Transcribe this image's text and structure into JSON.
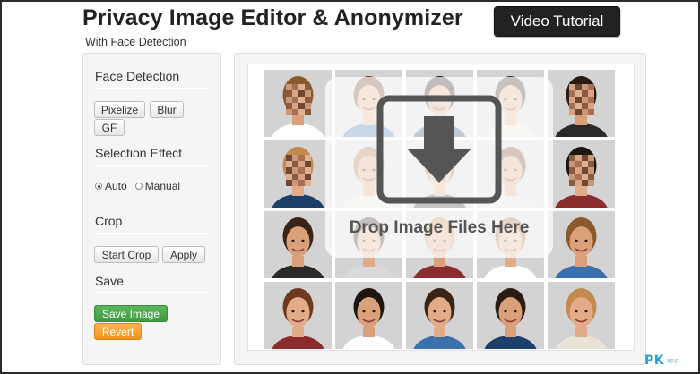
{
  "header": {
    "title": "Privacy Image Editor & Anonymizer",
    "subtitle": "With Face Detection",
    "video_button": "Video Tutorial"
  },
  "sidebar": {
    "face_detection": {
      "title": "Face Detection",
      "buttons": [
        "Pixelize",
        "Blur",
        "GF"
      ]
    },
    "selection_effect": {
      "title": "Selection Effect",
      "options": [
        "Auto",
        "Manual"
      ],
      "selected": "Auto"
    },
    "crop": {
      "title": "Crop",
      "buttons": [
        "Start Crop",
        "Apply"
      ]
    },
    "save": {
      "title": "Save",
      "save_button": "Save Image",
      "revert_button": "Revert"
    }
  },
  "main": {
    "drop_text": "Drop Image Files Here",
    "drop_icon": "download-arrow-icon"
  },
  "watermark": {
    "text": "PK",
    "sub": "app"
  },
  "colors": {
    "title_button_bg": "#222222",
    "save_green": "#4cae4c",
    "revert_orange": "#f0ad4e",
    "panel_bg": "#f5f5f5",
    "watermark_blue": "#2a9fd6"
  }
}
